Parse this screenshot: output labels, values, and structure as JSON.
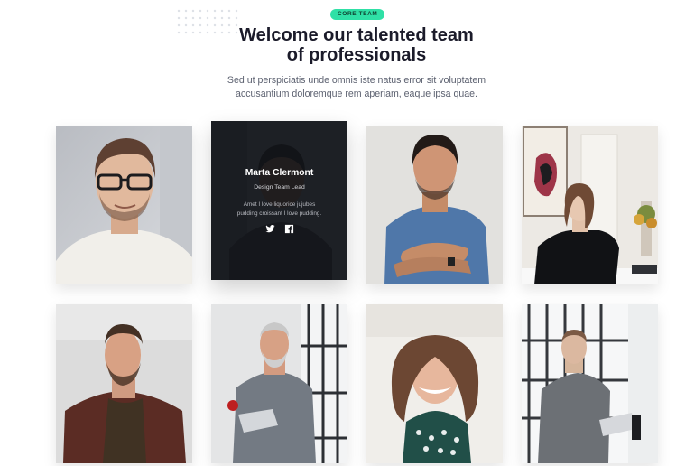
{
  "header": {
    "badge": "CORE TEAM",
    "title_line1": "Welcome our talented team",
    "title_line2": "of professionals",
    "subtitle_line1": "Sed ut perspiciatis unde omnis iste natus error sit voluptatem",
    "subtitle_line2": "accusantium doloremque rem aperiam, eaque ipsa quae."
  },
  "team": {
    "featured": {
      "name": "Marta Clermont",
      "role": "Design Team Lead",
      "bio_line1": "Amet I love liquorice jujubes",
      "bio_line2": "pudding croissant I love pudding.",
      "social": [
        "twitter-icon",
        "facebook-icon"
      ]
    }
  },
  "colors": {
    "accent": "#2fe0a6",
    "heading": "#1b1b2a",
    "text": "#5c6170",
    "overlay": "#101217"
  }
}
